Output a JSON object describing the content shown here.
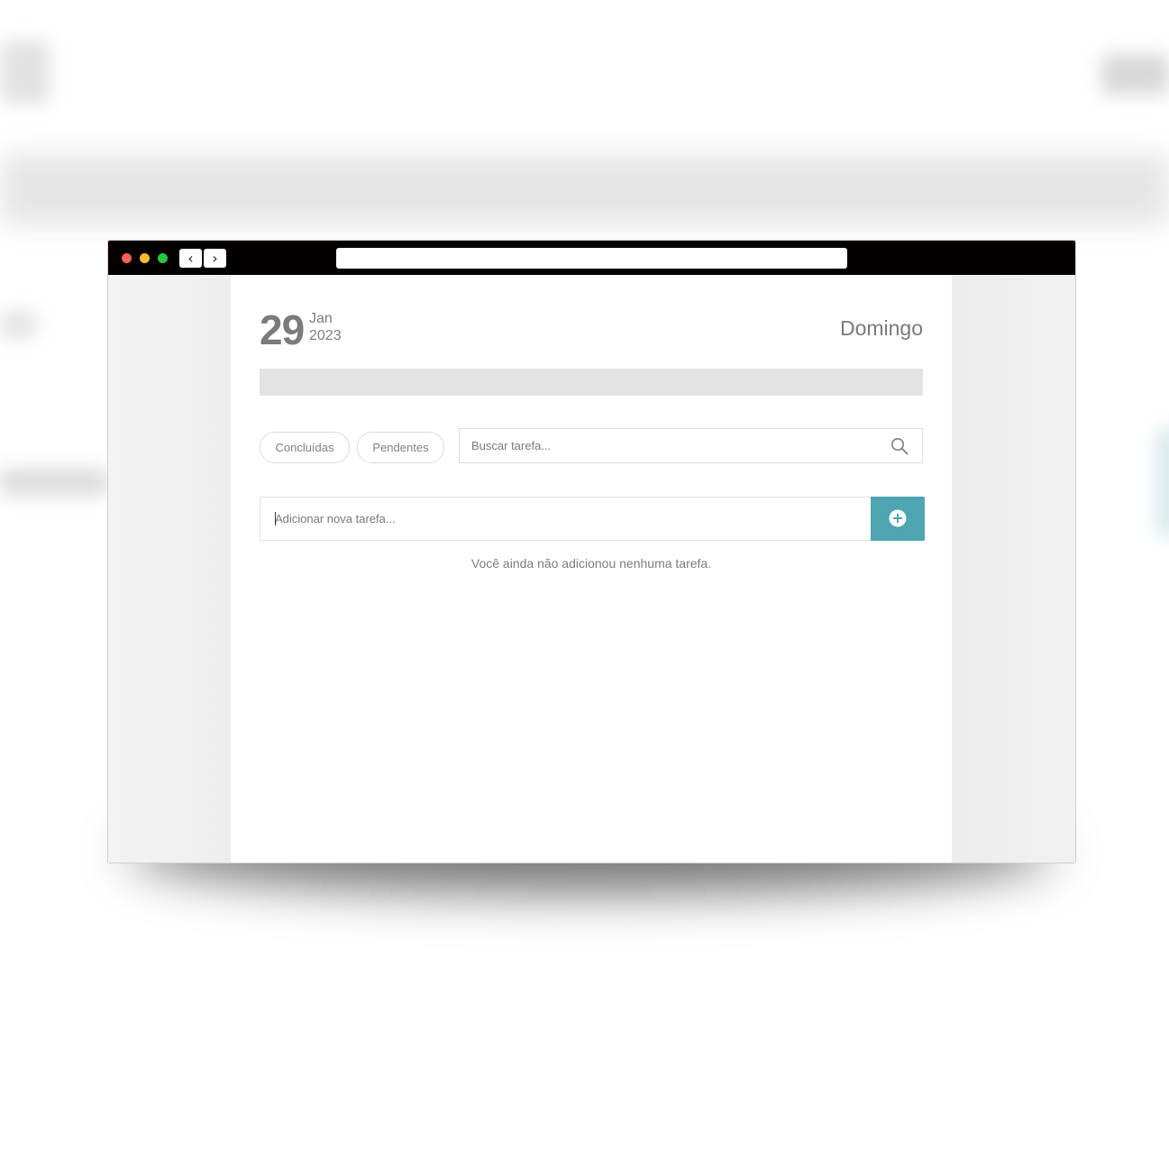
{
  "browser": {
    "nav_back_glyph": "‹",
    "nav_forward_glyph": "›",
    "url": ""
  },
  "header": {
    "day": "29",
    "month": "Jan",
    "year": "2023",
    "weekday": "Domingo"
  },
  "progress": {
    "completed_fraction": 0
  },
  "filters": {
    "done_label": "Concluídas",
    "pending_label": "Pendentes"
  },
  "search": {
    "value": "",
    "placeholder": "Buscar tarefa...",
    "icon": "search-icon"
  },
  "new_task": {
    "value": "",
    "placeholder": "Adicionar nova tarefa...",
    "button_icon": "plus-circle-icon"
  },
  "tasks": {
    "items": [],
    "empty_message": "Você ainda não adicionou nenhuma tarefa."
  },
  "colors": {
    "accent": "#4fa5b2",
    "text_muted": "#7b7b7b",
    "progress_track": "#e3e3e3",
    "titlebar": "#050000"
  }
}
